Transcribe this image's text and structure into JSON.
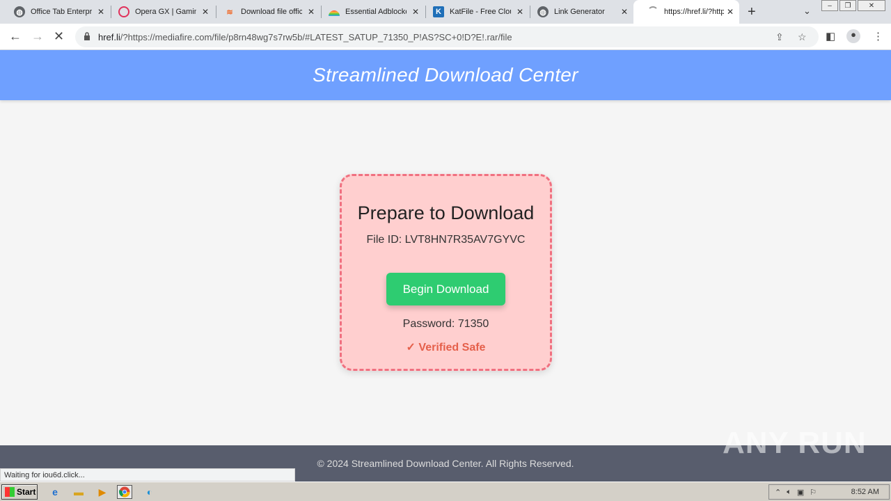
{
  "browser": {
    "tabs": [
      {
        "title": "Office Tab Enterprise",
        "icon": "globe-icon"
      },
      {
        "title": "Opera GX | Gaming Browser",
        "icon": "opera-icon"
      },
      {
        "title": "Download file officially",
        "icon": "layers-icon"
      },
      {
        "title": "Essential Adblocker",
        "icon": "rainbow-icon"
      },
      {
        "title": "KatFile - Free Cloud",
        "icon": "katfile-icon"
      },
      {
        "title": "Link Generator",
        "icon": "globe-icon"
      },
      {
        "title": "https://href.li/?https",
        "icon": "loading-icon"
      }
    ],
    "url_host": "href.li",
    "url_rest": "/?https://mediafire.com/file/p8rn48wg7s7rw5b/#LATEST_SATUP_71350_P!AS?SC+0!D?E!.rar/file",
    "status_text": "Waiting for iou6d.click..."
  },
  "page": {
    "header_title": "Streamlined Download Center",
    "card_title": "Prepare to Download",
    "file_id": "File ID: LVT8HN7R35AV7GYVC",
    "button_label": "Begin Download",
    "password": "Password: 71350",
    "verified": "✓ Verified Safe",
    "footer": "© 2024 Streamlined Download Center. All Rights Reserved."
  },
  "watermark": "ANY RUN",
  "taskbar": {
    "start_label": "Start",
    "clock": "8:52 AM"
  },
  "colors": {
    "header": "#6fa0ff",
    "card_bg": "#ffcfcf",
    "card_border": "#f07080",
    "button": "#2ecc71",
    "verified": "#e5604b",
    "footer": "#585d6d"
  }
}
